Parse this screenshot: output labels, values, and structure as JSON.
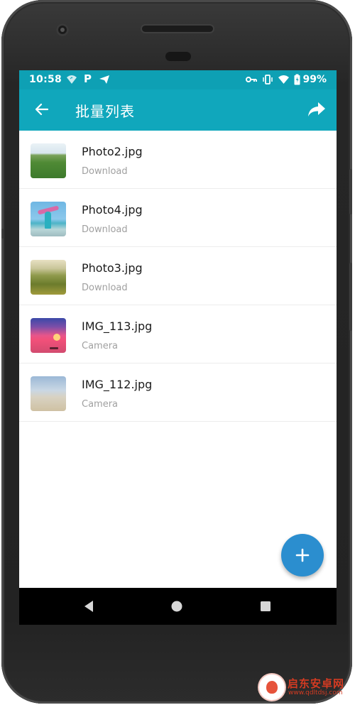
{
  "status_bar": {
    "time": "10:58",
    "battery": "99%",
    "icons": [
      "wifi-call-icon",
      "p-icon",
      "telegram-icon",
      "key-icon",
      "vibrate-icon",
      "wifi-icon",
      "battery-icon"
    ]
  },
  "app_bar": {
    "title": "批量列表",
    "back_icon": "arrow-left-icon",
    "share_icon": "share-arrow-icon",
    "color": "#10a7bc"
  },
  "files": [
    {
      "name": "Photo2.jpg",
      "folder": "Download",
      "thumb": "green-field-photo"
    },
    {
      "name": "Photo4.jpg",
      "folder": "Download",
      "thumb": "beach-woman-photo"
    },
    {
      "name": "Photo3.jpg",
      "folder": "Download",
      "thumb": "hills-photo"
    },
    {
      "name": "IMG_113.jpg",
      "folder": "Camera",
      "thumb": "sunset-photo"
    },
    {
      "name": "IMG_112.jpg",
      "folder": "Camera",
      "thumb": "sand-beach-photo"
    }
  ],
  "fab": {
    "icon": "plus-icon",
    "color": "#2b8ecf"
  },
  "nav_bar": {
    "icons": [
      "back-triangle-icon",
      "home-circle-icon",
      "recents-square-icon"
    ]
  },
  "watermark": {
    "brand": "启东安卓网",
    "url": "www.qdltdsj.com"
  }
}
